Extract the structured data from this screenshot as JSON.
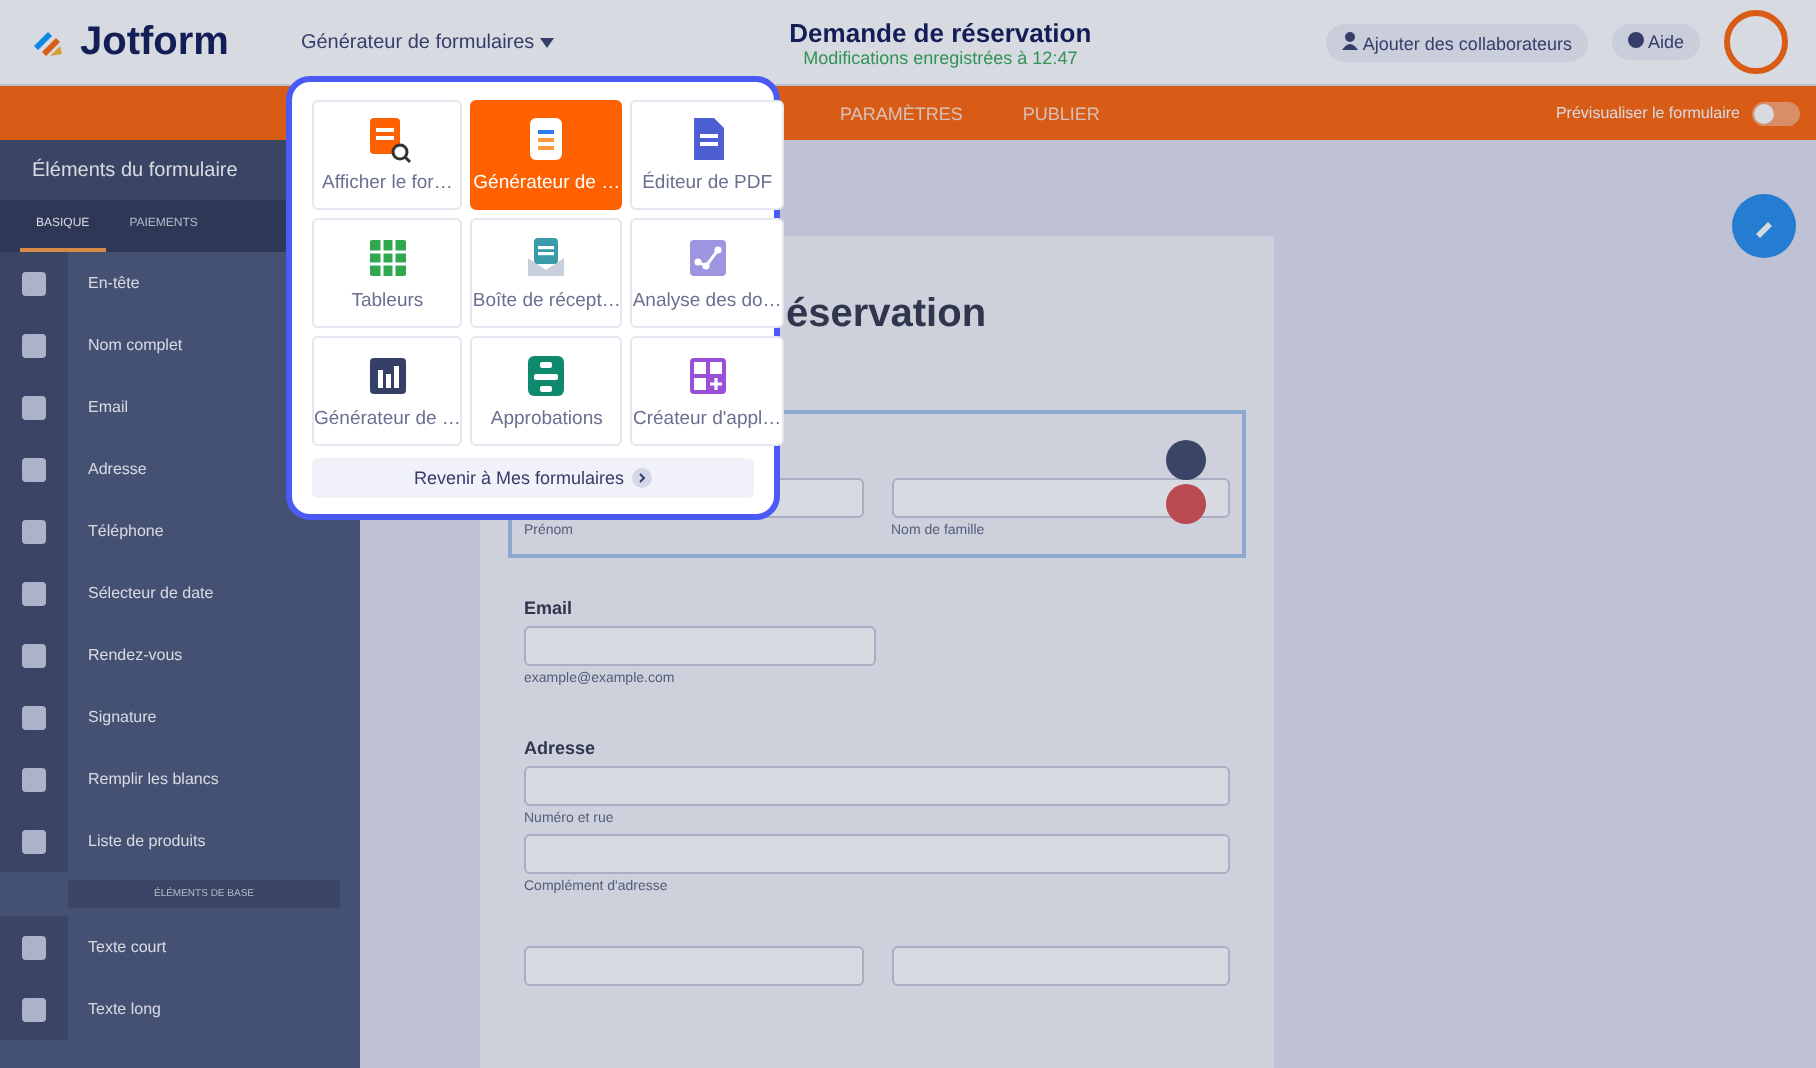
{
  "header": {
    "logo": "Jotform",
    "builder_menu": "Générateur de formulaires",
    "form_title": "Demande de réservation",
    "save_status": "Modifications enregistrées à 12:47",
    "collaborators_button": "Ajouter des collaborateurs",
    "help_button": "Aide"
  },
  "nav_tabs": [
    {
      "label": "PARAMÈTRES",
      "selected": false
    },
    {
      "label": "PUBLIER",
      "selected": false
    }
  ],
  "preview_toggle": {
    "label": "Prévisualiser le formulaire",
    "on": false
  },
  "sidebar": {
    "title": "Éléments du formulaire",
    "tabs": [
      {
        "label": "BASIQUE",
        "selected": true
      },
      {
        "label": "PAIEMENTS",
        "selected": false
      }
    ],
    "items": [
      {
        "label": "En-tête"
      },
      {
        "label": "Nom complet"
      },
      {
        "label": "Email"
      },
      {
        "label": "Adresse"
      },
      {
        "label": "Téléphone"
      },
      {
        "label": "Sélecteur de date"
      },
      {
        "label": "Rendez-vous"
      },
      {
        "label": "Signature"
      },
      {
        "label": "Remplir les blancs"
      },
      {
        "label": "Liste de produits"
      }
    ],
    "section_label": "ÉLÉMENTS DE BASE",
    "more_items": [
      {
        "label": "Texte court"
      },
      {
        "label": "Texte long"
      }
    ]
  },
  "form": {
    "title": "éservation",
    "fields": [
      {
        "kind": "pair",
        "selected": true,
        "sublabels": [
          "Prénom",
          "Nom de famille"
        ]
      },
      {
        "kind": "single",
        "label": "Email",
        "sublabels": [
          "example@example.com"
        ]
      },
      {
        "kind": "wide",
        "label": "Adresse",
        "sublabels": [
          "Numéro et rue",
          "Complément d'adresse"
        ]
      },
      {
        "kind": "pair"
      }
    ]
  },
  "app_menu": {
    "items": [
      {
        "label": "Afficher le for…",
        "selected": false
      },
      {
        "label": "Générateur de …",
        "selected": true
      },
      {
        "label": "Éditeur de PDF",
        "selected": false
      },
      {
        "label": "Tableurs",
        "selected": false
      },
      {
        "label": "Boîte de récept…",
        "selected": false
      },
      {
        "label": "Analyse des do…",
        "selected": false
      },
      {
        "label": "Générateur de …",
        "selected": false
      },
      {
        "label": "Approbations",
        "selected": false
      },
      {
        "label": "Créateur d'appl…",
        "selected": false
      }
    ],
    "back_link": "Revenir à Mes formulaires"
  }
}
